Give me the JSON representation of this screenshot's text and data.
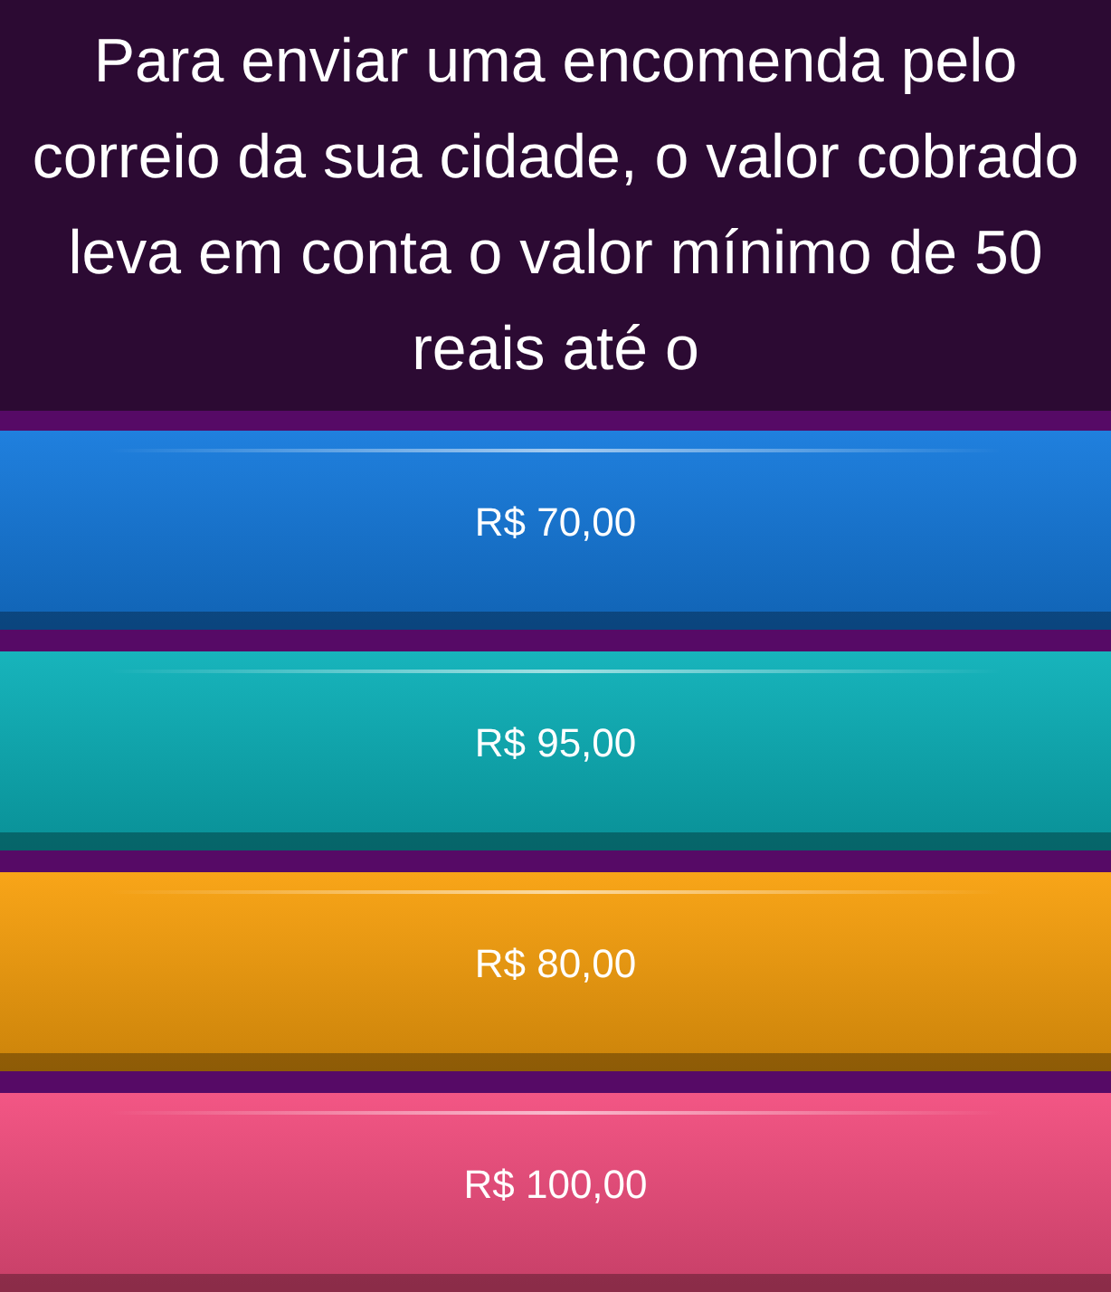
{
  "question": {
    "text": "Para enviar uma encomenda pelo correio da sua cidade, o valor cobrado leva em conta o valor mínimo de 50 reais até o"
  },
  "answers": [
    {
      "label": "R$ 70,00",
      "color": "#1479dc"
    },
    {
      "label": "R$ 95,00",
      "color": "#0bb0b8"
    },
    {
      "label": "R$ 80,00",
      "color": "#f8a00c"
    },
    {
      "label": "R$ 100,00",
      "color": "#f24d7e"
    }
  ]
}
